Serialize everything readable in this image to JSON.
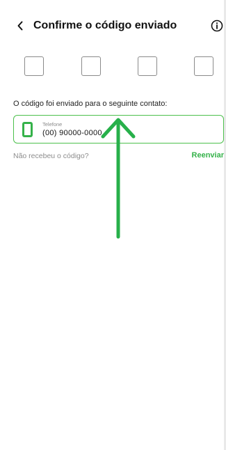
{
  "header": {
    "back_icon": "chevron-left-icon",
    "title": "Confirme o código enviado",
    "info_icon": "info-circle-icon"
  },
  "code_inputs": [
    "",
    "",
    "",
    ""
  ],
  "contact": {
    "intro_text": "O código foi enviado para o seguinte contato:",
    "label": "Telefone",
    "value": "(00) 90000-0000",
    "icon": "phone-icon"
  },
  "resend": {
    "question": "Não recebeu o código?",
    "link_label": "Reenviar"
  },
  "colors": {
    "accent": "#35b24a",
    "card_border": "#4cc04c",
    "annotation_arrow": "#27b04a"
  }
}
